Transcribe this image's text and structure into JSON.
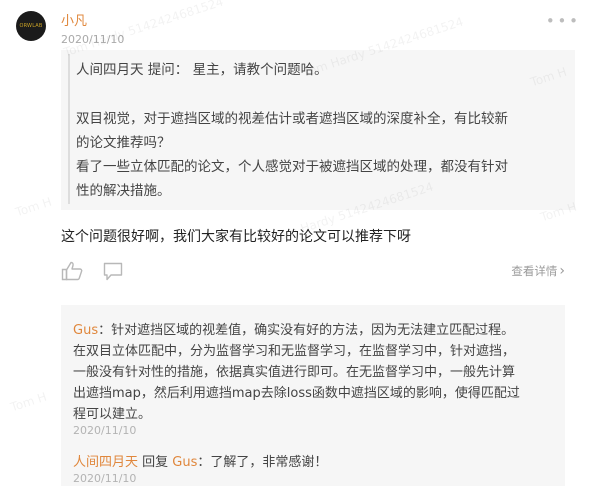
{
  "post": {
    "avatar_text": "ORWLAB",
    "author": "小凡",
    "date": "2020/11/10",
    "more_icon": "ellipsis-icon",
    "quote_lines": [
      "人间四月天  提问：  星主，请教个问题哈。",
      "双目视觉，对于遮挡区域的视差估计或者遮挡区域的深度补全，有比较新",
      "的论文推荐吗？",
      "看了一些立体匹配的论文，个人感觉对于被遮挡区域的处理，都没有针对",
      "性的解决措施。"
    ],
    "reply_text": "这个问题很好啊，我们大家有比较好的论文可以推荐下呀",
    "actions": {
      "like_icon": "thumbs-up-icon",
      "comment_icon": "comment-bubble-icon",
      "detail_label": "查看详情",
      "detail_icon": "chevron-right-icon"
    }
  },
  "thread": {
    "comment1": {
      "author": "Gus",
      "lines": [
        "：针对遮挡区域的视差值，确实没有好的方法，因为无法建立匹配过程。",
        "在双目立体匹配中，分为监督学习和无监督学习，在监督学习中，针对遮挡，",
        "一般没有针对性的措施，依据真实值进行即可。在无监督学习中，一般先计算",
        "出遮挡map，然后利用遮挡map去除loss函数中遮挡区域的影响，使得匹配过",
        "程可以建立。"
      ],
      "date": "2020/11/10"
    },
    "comment2": {
      "author": "人间四月天",
      "reply_word": " 回复 ",
      "target": "Gus",
      "text": "：了解了，非常感谢！",
      "date": "2020/11/10"
    }
  },
  "watermark": {
    "text_a": "Tom Hardy 5142424681524",
    "text_b": "Tom H"
  }
}
